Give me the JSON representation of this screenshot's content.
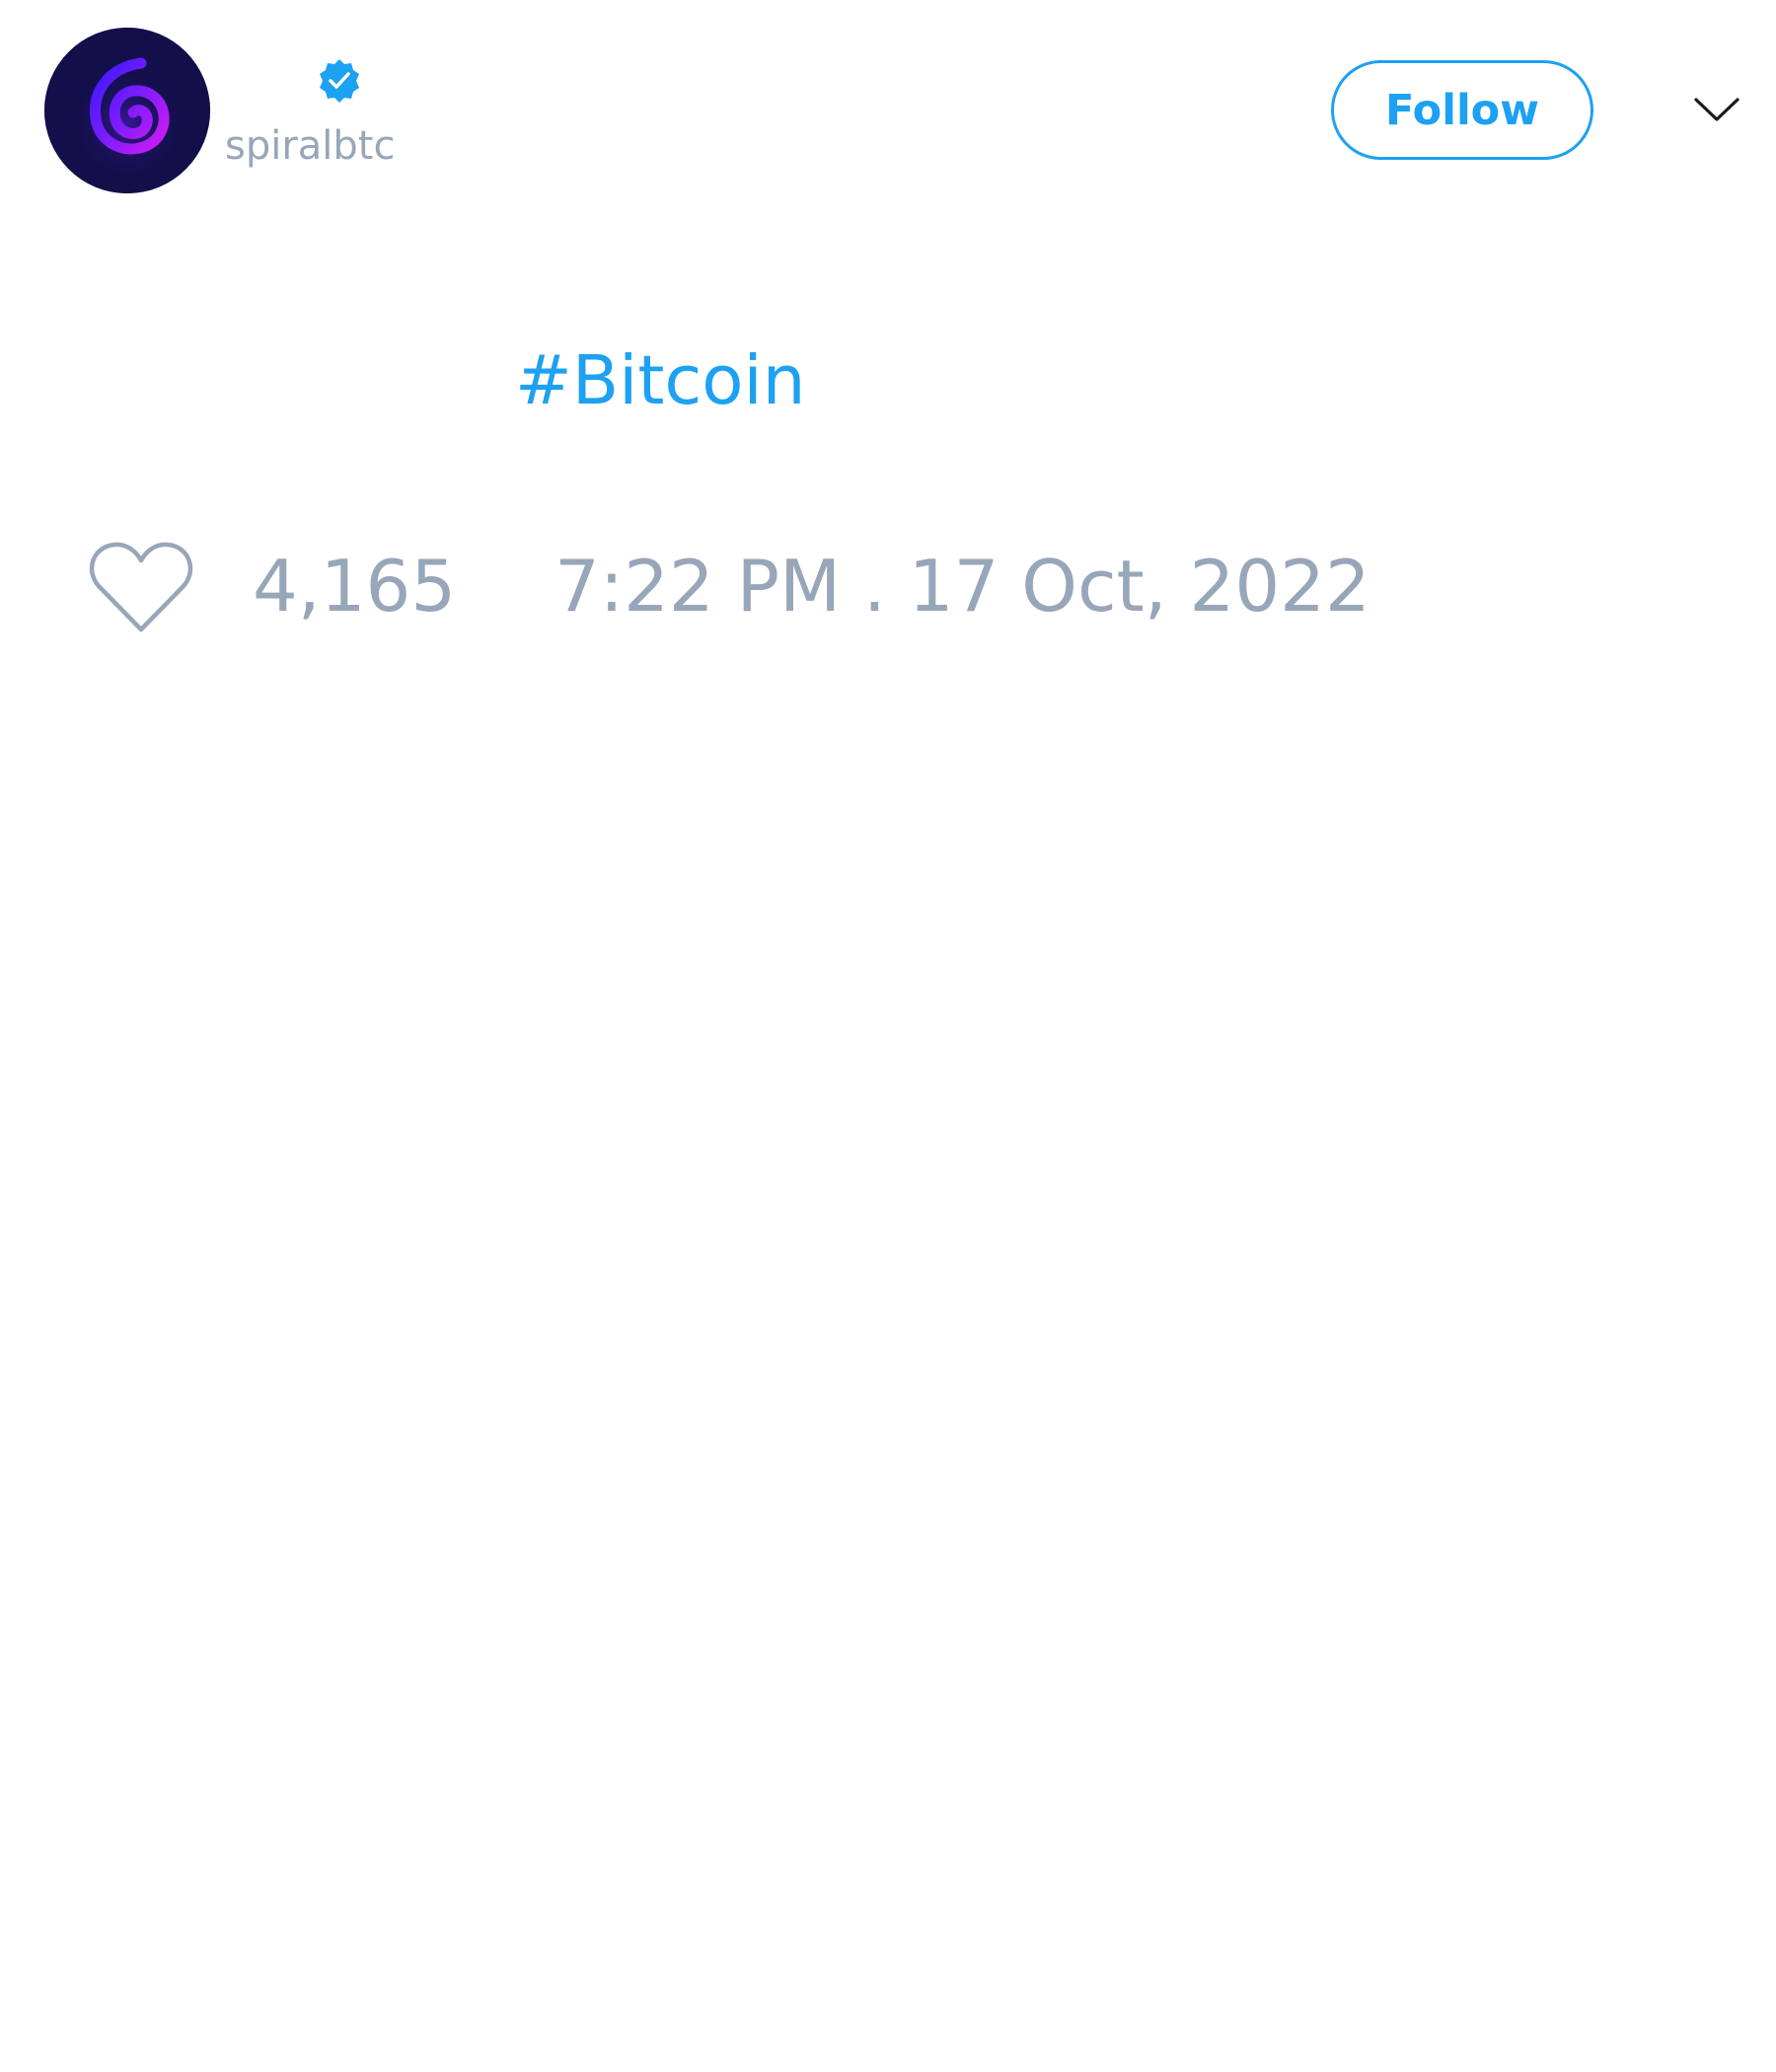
{
  "author": {
    "handle": "spiralbtc",
    "verified_icon": "verified-badge-icon",
    "avatar_icon": "spiral-logo"
  },
  "actions": {
    "follow_label": "Follow",
    "menu_icon": "chevron-down-icon"
  },
  "tweet": {
    "hashtag": "#Bitcoin"
  },
  "footer": {
    "like_icon": "heart-icon",
    "like_count": "4,165",
    "timestamp": "7:22 PM . 17 Oct, 2022"
  },
  "colors": {
    "accent": "#1da1f2",
    "muted_text": "#98a6ba",
    "avatar_background": "#120f4a"
  }
}
